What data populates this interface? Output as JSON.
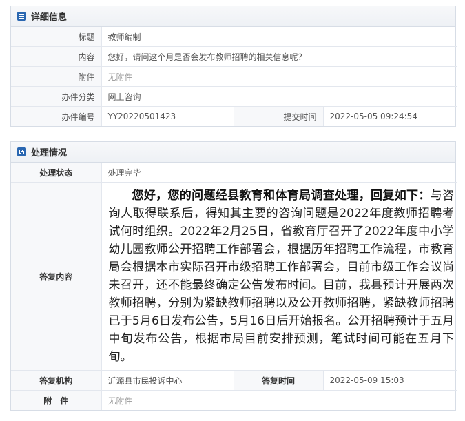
{
  "detail": {
    "section_title": "详细信息",
    "title_label": "标题",
    "title_value": "教师编制",
    "content_label": "内容",
    "content_value": "您好，请问这个月是否会发布教师招聘的相关信息呢？",
    "attachment_label": "附件",
    "attachment_value": "无附件",
    "category_label": "办件分类",
    "category_value": "网上咨询",
    "number_label": "办件编号",
    "number_value": "YY20220501423",
    "submit_time_label": "提交时间",
    "submit_time_value": "2022-05-05 09:24:54"
  },
  "handling": {
    "section_title": "处理情况",
    "status_label": "处理状态",
    "status_value": "处理完毕",
    "reply_label": "答复内容",
    "reply_lead": "您好，您的问题经县教育和体育局调查处理，回复如下：",
    "reply_body": "与咨询人取得联系后，得知其主要的咨询问题是2022年度教师招聘考试何时组织。2022年2月25日，省教育厅召开了2022年度中小学幼儿园教师公开招聘工作部署会，根据历年招聘工作流程，市教育局会根据本市实际召开市级招聘工作部署会，目前市级工作会议尚未召开，还不能最终确定公告发布时间。目前，我县预计开展两次教师招聘，分别为紧缺教师招聘以及公开教师招聘，紧缺教师招聘已于5月6日发布公告，5月16日后开始报名。公开招聘预计于五月中旬发布公告，根据市局目前安排预测，笔试时间可能在五月下旬。",
    "org_label": "答复机构",
    "org_value": "沂源县市民投诉中心",
    "reply_time_label": "答复时间",
    "reply_time_value": "2022-05-09 15:03",
    "attachment_label": "附　件",
    "attachment_value": "无附件"
  },
  "colors": {
    "icon": "#2a67b1",
    "border": "#d7dde6",
    "label_bg": "#f7f8fa"
  },
  "icons": {
    "detail": "list-icon",
    "handling": "copy-icon"
  }
}
